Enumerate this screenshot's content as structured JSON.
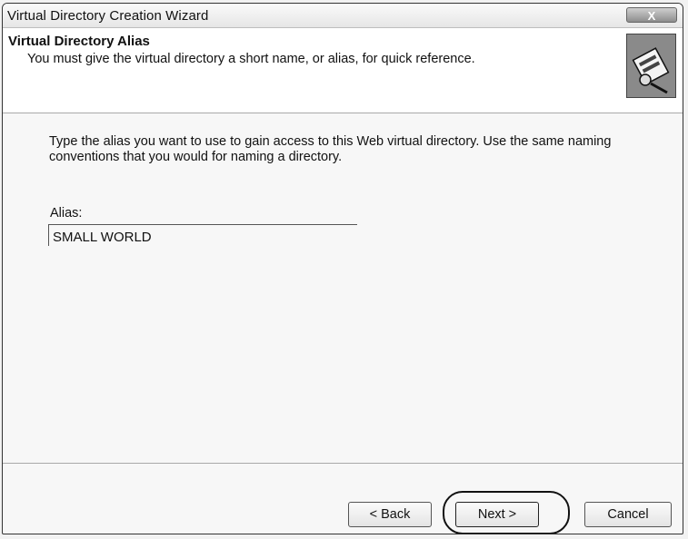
{
  "window": {
    "title": "Virtual Directory Creation Wizard",
    "close_label": "X"
  },
  "header": {
    "title": "Virtual Directory Alias",
    "subtitle": "You must give the virtual directory a short name, or alias, for quick reference.",
    "icon": "wizard-icon"
  },
  "content": {
    "instruction": "Type the alias you want to use to gain access to this Web virtual directory. Use the same naming conventions that you would for naming a directory.",
    "alias_label": "Alias:",
    "alias_value": "SMALL WORLD"
  },
  "buttons": {
    "back": "< Back",
    "next": "Next >",
    "cancel": "Cancel"
  }
}
